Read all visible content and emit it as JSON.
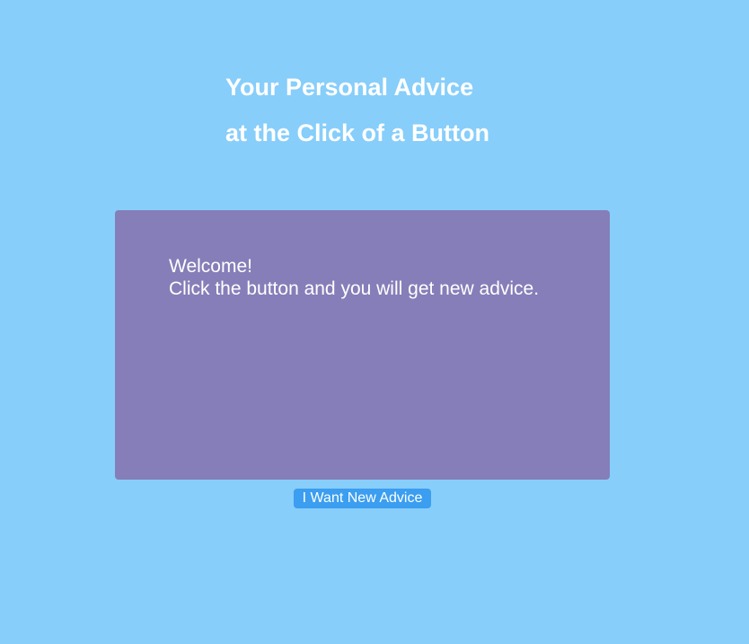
{
  "header": {
    "title_line1": "Your Personal Advice",
    "title_line2": "at the Click of a Button"
  },
  "advice": {
    "greeting": "Welcome!",
    "message": "Click the button and you will get new advice."
  },
  "actions": {
    "new_advice_label": "I Want New Advice"
  },
  "colors": {
    "background": "#87cefa",
    "card": "#867eb8",
    "button": "#3b9ef0",
    "text": "#ffffff"
  }
}
